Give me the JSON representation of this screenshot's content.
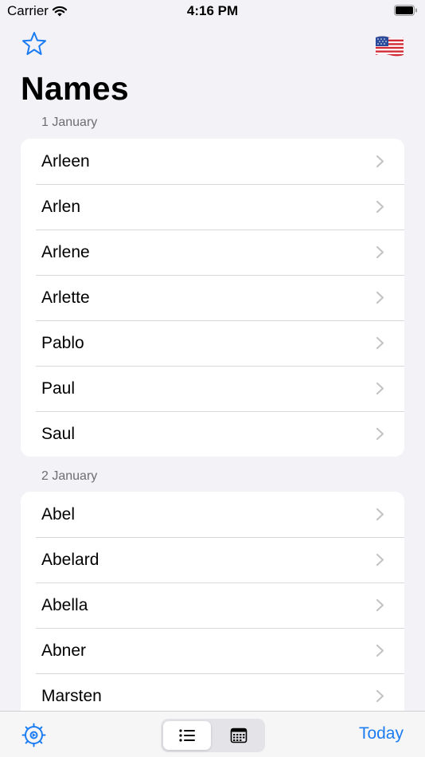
{
  "status_bar": {
    "carrier": "Carrier",
    "time": "4:16 PM"
  },
  "nav": {
    "title": "Names",
    "left_icon": "star-icon",
    "right_icon": "us-flag-icon"
  },
  "sections": [
    {
      "header": "1 January",
      "names": [
        "Arleen",
        "Arlen",
        "Arlene",
        "Arlette",
        "Pablo",
        "Paul",
        "Saul"
      ]
    },
    {
      "header": "2 January",
      "names": [
        "Abel",
        "Abelard",
        "Abella",
        "Abner",
        "Marsten"
      ]
    }
  ],
  "toolbar": {
    "settings_icon": "gear-icon",
    "segments": [
      "list-icon",
      "calendar-icon"
    ],
    "selected_segment": "list-icon",
    "today_label": "Today"
  },
  "colors": {
    "accent": "#1c7cf2",
    "background": "#f2f2f7",
    "secondary_text": "#6d6d72",
    "chevron": "#c4c4c7"
  }
}
